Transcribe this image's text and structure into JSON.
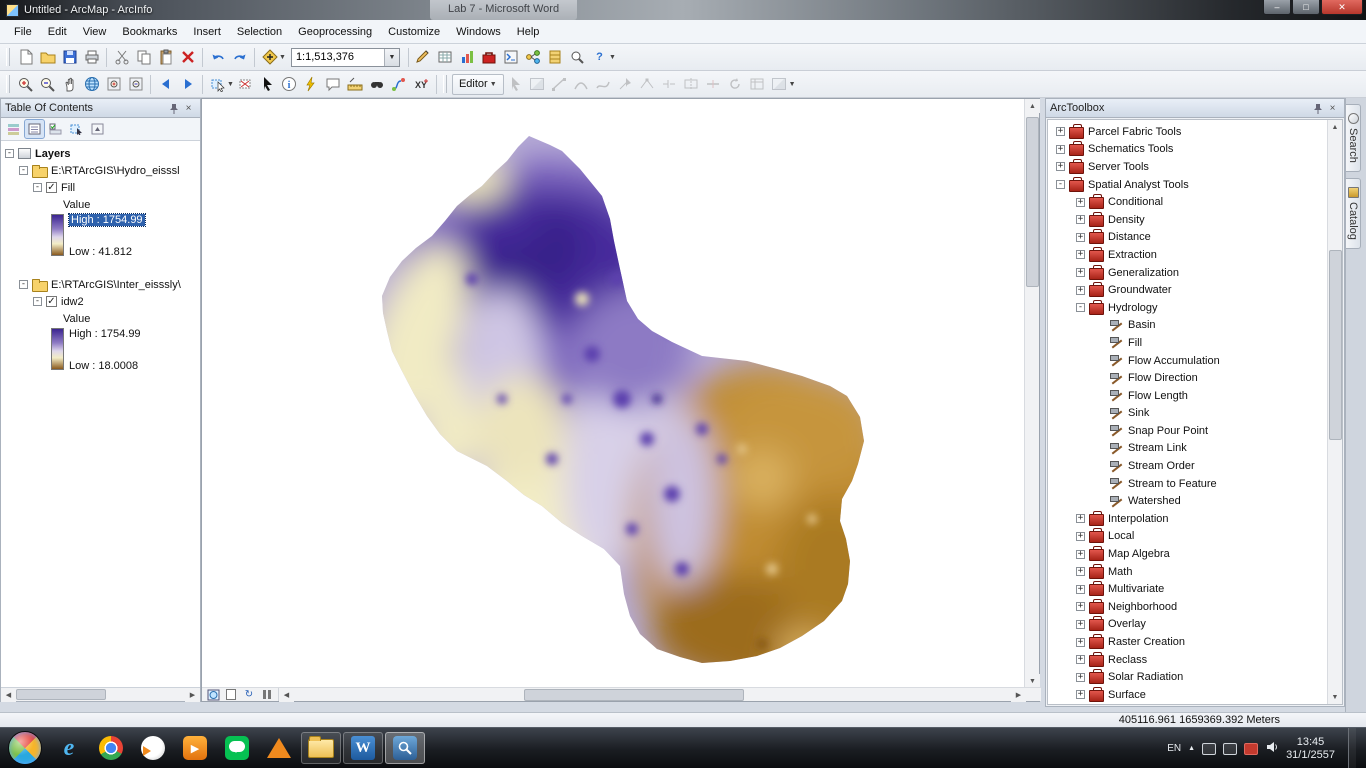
{
  "titlebar": {
    "app_title": "Untitled - ArcMap - ArcInfo",
    "background_title": "Lab 7 - Microsoft Word",
    "minimize": "–",
    "maximize": "□",
    "close": "✕"
  },
  "menu": {
    "items": [
      "File",
      "Edit",
      "View",
      "Bookmarks",
      "Insert",
      "Selection",
      "Geoprocessing",
      "Customize",
      "Windows",
      "Help"
    ]
  },
  "toolbars": {
    "scale_value": "1:1,513,376",
    "editor_label": "Editor"
  },
  "toc": {
    "title": "Table Of Contents",
    "root_label": "Layers",
    "groups": [
      {
        "path": "E:\\RTArcGIS\\Hydro_eisssl",
        "layer": "Fill",
        "field": "Value",
        "high": "High : 1754.99",
        "low": "Low : 41.812"
      },
      {
        "path": "E:\\RTArcGIS\\Inter_eisssly\\",
        "layer": "idw2",
        "field": "Value",
        "high": "High : 1754.99",
        "low": "Low : 18.0008"
      }
    ]
  },
  "arctoolbox": {
    "title": "ArcToolbox",
    "items": [
      {
        "label": "Parcel Fabric Tools",
        "level": "lv0",
        "exp": "plus",
        "icon": "toolbox"
      },
      {
        "label": "Schematics Tools",
        "level": "lv0",
        "exp": "plus",
        "icon": "toolbox"
      },
      {
        "label": "Server Tools",
        "level": "lv0",
        "exp": "plus",
        "icon": "toolbox"
      },
      {
        "label": "Spatial Analyst Tools",
        "level": "lv0",
        "exp": "minus",
        "icon": "toolbox"
      },
      {
        "label": "Conditional",
        "level": "lv1",
        "exp": "plus",
        "icon": "toolbox"
      },
      {
        "label": "Density",
        "level": "lv1",
        "exp": "plus",
        "icon": "toolbox"
      },
      {
        "label": "Distance",
        "level": "lv1",
        "exp": "plus",
        "icon": "toolbox"
      },
      {
        "label": "Extraction",
        "level": "lv1",
        "exp": "plus",
        "icon": "toolbox"
      },
      {
        "label": "Generalization",
        "level": "lv1",
        "exp": "plus",
        "icon": "toolbox"
      },
      {
        "label": "Groundwater",
        "level": "lv1",
        "exp": "plus",
        "icon": "toolbox"
      },
      {
        "label": "Hydrology",
        "level": "lv1",
        "exp": "minus",
        "icon": "toolbox"
      },
      {
        "label": "Basin",
        "level": "lv2",
        "exp": "leaf",
        "icon": "tool"
      },
      {
        "label": "Fill",
        "level": "lv2",
        "exp": "leaf",
        "icon": "tool"
      },
      {
        "label": "Flow Accumulation",
        "level": "lv2",
        "exp": "leaf",
        "icon": "tool"
      },
      {
        "label": "Flow Direction",
        "level": "lv2",
        "exp": "leaf",
        "icon": "tool"
      },
      {
        "label": "Flow Length",
        "level": "lv2",
        "exp": "leaf",
        "icon": "tool"
      },
      {
        "label": "Sink",
        "level": "lv2",
        "exp": "leaf",
        "icon": "tool"
      },
      {
        "label": "Snap Pour Point",
        "level": "lv2",
        "exp": "leaf",
        "icon": "tool"
      },
      {
        "label": "Stream Link",
        "level": "lv2",
        "exp": "leaf",
        "icon": "tool"
      },
      {
        "label": "Stream Order",
        "level": "lv2",
        "exp": "leaf",
        "icon": "tool"
      },
      {
        "label": "Stream to Feature",
        "level": "lv2",
        "exp": "leaf",
        "icon": "tool"
      },
      {
        "label": "Watershed",
        "level": "lv2",
        "exp": "leaf",
        "icon": "tool"
      },
      {
        "label": "Interpolation",
        "level": "lv1",
        "exp": "plus",
        "icon": "toolbox"
      },
      {
        "label": "Local",
        "level": "lv1",
        "exp": "plus",
        "icon": "toolbox"
      },
      {
        "label": "Map Algebra",
        "level": "lv1",
        "exp": "plus",
        "icon": "toolbox"
      },
      {
        "label": "Math",
        "level": "lv1",
        "exp": "plus",
        "icon": "toolbox"
      },
      {
        "label": "Multivariate",
        "level": "lv1",
        "exp": "plus",
        "icon": "toolbox"
      },
      {
        "label": "Neighborhood",
        "level": "lv1",
        "exp": "plus",
        "icon": "toolbox"
      },
      {
        "label": "Overlay",
        "level": "lv1",
        "exp": "plus",
        "icon": "toolbox"
      },
      {
        "label": "Raster Creation",
        "level": "lv1",
        "exp": "plus",
        "icon": "toolbox"
      },
      {
        "label": "Reclass",
        "level": "lv1",
        "exp": "plus",
        "icon": "toolbox"
      },
      {
        "label": "Solar Radiation",
        "level": "lv1",
        "exp": "plus",
        "icon": "toolbox"
      },
      {
        "label": "Surface",
        "level": "lv1",
        "exp": "plus",
        "icon": "toolbox"
      }
    ]
  },
  "side_tabs": {
    "search": "Search",
    "catalog": "Catalog"
  },
  "statusbar": {
    "coordinates": "405116.961  1659369.392 Meters"
  },
  "taskbar": {
    "language": "EN",
    "time": "13:45",
    "date": "31/1/2557"
  },
  "map_legend_colors": {
    "high_purple": "#3b2490",
    "lavender": "#b6abd6",
    "cream": "#f3edc6",
    "tan": "#c08c30",
    "brown": "#9c6c1e"
  }
}
